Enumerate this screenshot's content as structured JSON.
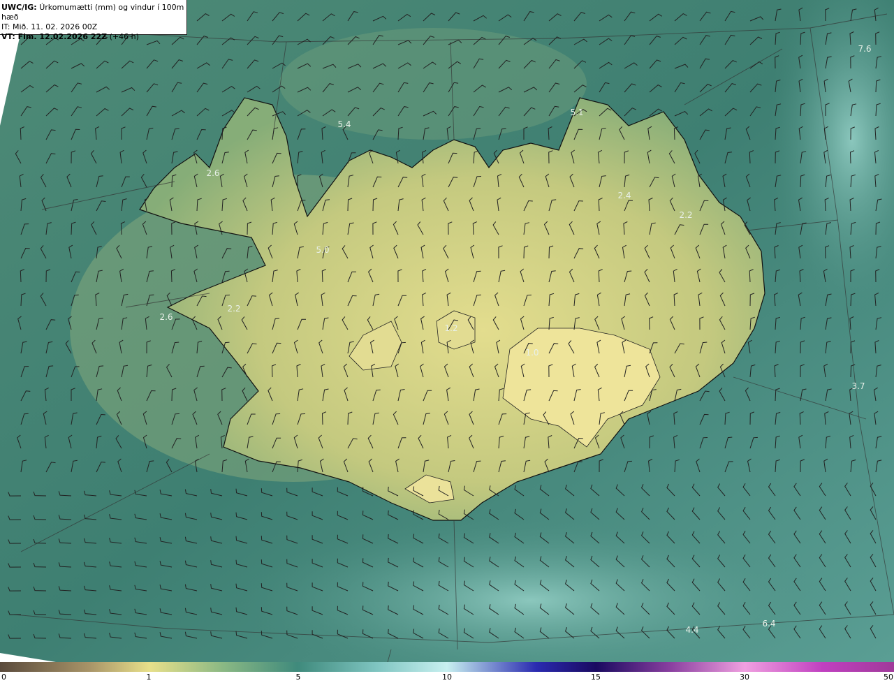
{
  "header": {
    "product": "UWC/IG:",
    "title": "Úrkomumætti (mm) og vindur í 100m hæð",
    "it_line": "IT: Mið. 11. 02. 2026 00Z",
    "vt_label": "VT: Fim. 12.02.2026 22Z",
    "vt_lead": "(+46 h)"
  },
  "values": [
    "7.6",
    "5.4",
    "5.1",
    "2.6",
    "2.4",
    "2.2",
    "5.0",
    "2.2",
    "2.6",
    "1.2",
    "1.0",
    "3.7",
    "4.4",
    "6.4"
  ],
  "colorbar": {
    "ticks": [
      "0",
      "1",
      "5",
      "10",
      "15",
      "30",
      "50"
    ],
    "colors": [
      "#5a4a3c",
      "#a89468",
      "#e8e08a",
      "#8ab884",
      "#3f8a7c",
      "#7ec4c0",
      "#c8f0f0",
      "#2a2ab0",
      "#1a0a60",
      "#8a40a0",
      "#f0a0e0",
      "#c040c0",
      "#a03a9a"
    ]
  },
  "colors": {
    "sea": "#3d8273",
    "land": "#d6d488",
    "coast": "#111111"
  }
}
